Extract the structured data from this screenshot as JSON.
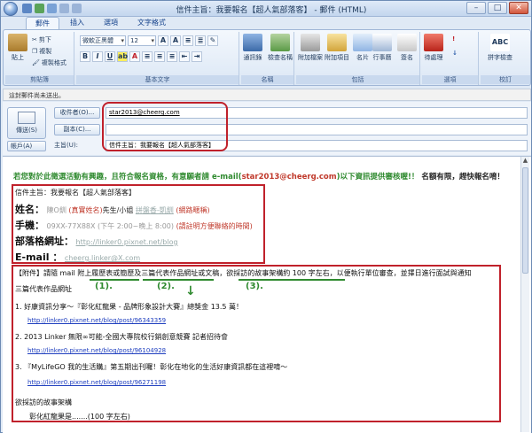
{
  "window": {
    "title": "信件主旨：我要報名【超人氣部落客】 - 郵件 (HTML)",
    "controls": [
      "–",
      "□",
      "✕"
    ]
  },
  "tabs": [
    "郵件",
    "插入",
    "選項",
    "文字格式"
  ],
  "ribbon": {
    "clipboard": {
      "paste": "貼上",
      "cut": "剪下",
      "copy": "複製",
      "format_painter": "複製格式",
      "label": "剪貼簿"
    },
    "basic_text": {
      "font": "微軟正黑體",
      "size": "12",
      "label": "基本文字"
    },
    "names": {
      "address_book": "通訊錄",
      "check_names": "檢查名稱",
      "label": "名稱"
    },
    "include": {
      "attach_file": "附加檔案",
      "attach_item": "附加項目",
      "business_card": "名片",
      "calendar": "行事曆",
      "signature": "簽名",
      "label": "包括"
    },
    "options": {
      "follow_up": "待處理",
      "label": "選項"
    },
    "proofing": {
      "spelling": "拼字檢查",
      "label": "校訂"
    }
  },
  "infobar": "這封郵件尚未送出。",
  "compose": {
    "send": "傳送(S)",
    "account": "帳戶(A)",
    "to_button": "收件者(O)...",
    "cc_button": "副本(C)...",
    "subject_label": "主旨(U):",
    "to_value": "star2013@cheerg.com",
    "cc_value": "",
    "subject_value": "信件主旨：我要報名【超人氣部落客】"
  },
  "body": {
    "promo_green": "若您對於此徵選活動有興趣，且符合報名資格，有意願者請 e-mail(",
    "promo_email": "star2013@cheerg.com",
    "promo_green2": ")以下資訊提供審核喔!！",
    "promo_tail": "名額有限，趕快報名唷！",
    "form": {
      "subject_line": "信件主旨：我要報名【超人氣部落客】",
      "name_label": "姓名：",
      "name_value": "陳O釧",
      "name_note": "(真實姓名)",
      "name_title": "先生/小姐",
      "nickname": "拼盤香-凱釧",
      "nickname_note": "(網路暱稱)",
      "phone_label": "手機：",
      "phone_value": "09XX-77X88X",
      "phone_time": "(下午 2:00~晚上 8:00)",
      "phone_note": "(請註明方便聯絡的時間)",
      "blog_label": "部落格網址：",
      "blog_value": "http://linker0.pixnet.net/blog",
      "email_label": "E-mail ：",
      "email_value": "cheerg.linker@X.com"
    },
    "attachment": {
      "line1": "【附件】請隨 mail 附上履歷表或簡歷及三篇代表作品網址或文稿，欲採訪的故事架構約 100 字左右，以便執行單位審查，並擇日進行面試與通知",
      "line2": "三篇代表作品網址",
      "marks": [
        "(1).",
        "(2).",
        "(3)."
      ],
      "arrow": "↓"
    },
    "items": [
      {
        "text": "1.   好康資訊分享～『彰化紅龍果 - 品牌形象設計大賽』總獎金 13.5 萬！",
        "link": "http://linker0.pixnet.net/blog/post/96343359"
      },
      {
        "text": "2.   2013 Linker 無限∞可能-全國大專院校行銷創意競賽  記者招待會",
        "link": "http://linker0.pixnet.net/blog/post/96104928"
      },
      {
        "text": "3.   『MyLifeGO 我的生活購』第五期出刊囉！彰化在地化的生活好康資訊都在這裡唷～",
        "link": "http://linker0.pixnet.net/blog/post/96271198"
      }
    ],
    "story_heading": "欲採訪的故事架構",
    "story_line": "彰化紅龍果是.......(100 字左右)"
  },
  "colors": {
    "red_box": "#c0212b",
    "green": "#2f8a2f",
    "link": "#1f3fbf"
  }
}
